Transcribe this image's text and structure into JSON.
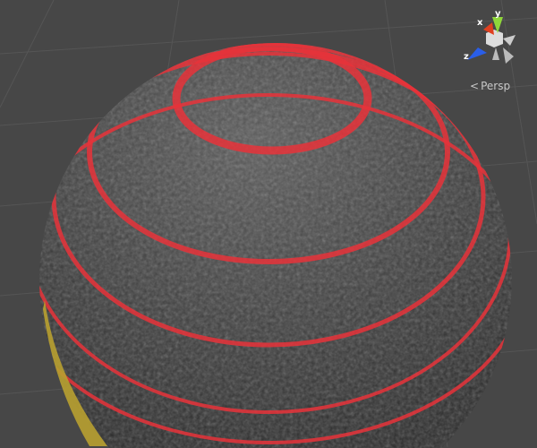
{
  "scene_view": {
    "gizmo": {
      "x_label": "x",
      "y_label": "y",
      "z_label": "z"
    },
    "projection_label": "Persp",
    "colors": {
      "background": "#474747",
      "grid": "#555555",
      "ring": "#e8333a",
      "sphere": "#3a3a3a",
      "x_axis": "#e04020",
      "y_axis": "#8fd63a",
      "z_axis": "#2a5ee8"
    }
  }
}
